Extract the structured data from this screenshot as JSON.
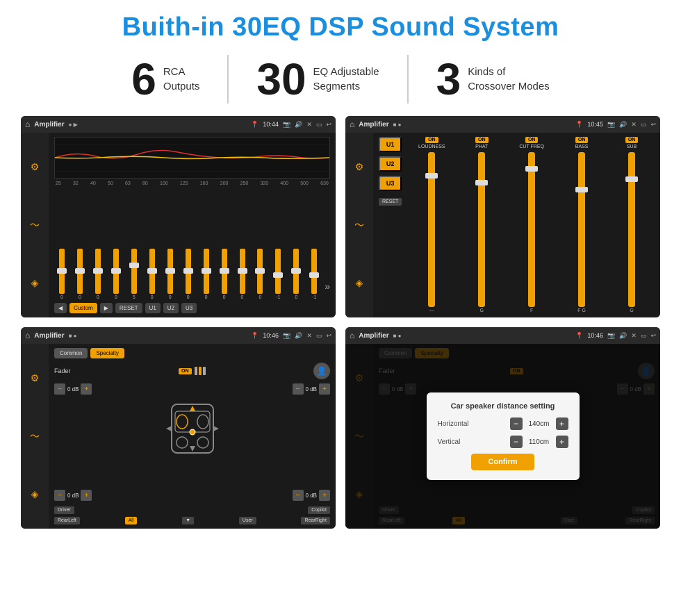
{
  "page": {
    "main_title": "Buith-in 30EQ DSP Sound System",
    "stats": [
      {
        "number": "6",
        "text_line1": "RCA",
        "text_line2": "Outputs"
      },
      {
        "number": "30",
        "text_line1": "EQ Adjustable",
        "text_line2": "Segments"
      },
      {
        "number": "3",
        "text_line1": "Kinds of",
        "text_line2": "Crossover Modes"
      }
    ],
    "screens": [
      {
        "id": "eq-screen",
        "topbar_title": "Amplifier",
        "topbar_time": "10:44",
        "type": "eq"
      },
      {
        "id": "crossover-screen",
        "topbar_title": "Amplifier",
        "topbar_time": "10:45",
        "type": "crossover"
      },
      {
        "id": "fader-screen",
        "topbar_title": "Amplifier",
        "topbar_time": "10:46",
        "type": "fader"
      },
      {
        "id": "dialog-screen",
        "topbar_title": "Amplifier",
        "topbar_time": "10:46",
        "type": "dialog"
      }
    ],
    "eq_freqs": [
      "25",
      "32",
      "40",
      "50",
      "63",
      "80",
      "100",
      "125",
      "160",
      "200",
      "250",
      "320",
      "400",
      "500",
      "630"
    ],
    "eq_values": [
      "0",
      "0",
      "0",
      "0",
      "5",
      "0",
      "0",
      "0",
      "0",
      "0",
      "0",
      "0",
      "-1",
      "0",
      "-1"
    ],
    "eq_buttons": [
      "Custom",
      "RESET",
      "U1",
      "U2",
      "U3"
    ],
    "crossover_channels": [
      {
        "label": "LOUDNESS",
        "on": true
      },
      {
        "label": "PHAT",
        "on": true
      },
      {
        "label": "CUT FREQ",
        "on": true
      },
      {
        "label": "BASS",
        "on": true
      },
      {
        "label": "SUB",
        "on": true
      }
    ],
    "u_buttons": [
      "U1",
      "U2",
      "U3"
    ],
    "fader": {
      "tabs": [
        "Common",
        "Specialty"
      ],
      "active_tab": "Specialty",
      "fader_label": "Fader",
      "fader_on": "ON",
      "vol_controls": [
        {
          "label": "— 0 dB +",
          "left": true
        },
        {
          "label": "— 0 dB +",
          "left": false
        }
      ],
      "vol_controls2": [
        {
          "label": "— 0 dB +",
          "left": true
        },
        {
          "label": "— 0 dB +",
          "left": false
        }
      ],
      "speaker_buttons": [
        "Driver",
        "",
        "",
        "",
        "Copilot"
      ],
      "bottom_buttons": [
        "RearLeft",
        "All",
        "",
        "User",
        "RearRight"
      ]
    },
    "dialog": {
      "title": "Car speaker distance setting",
      "horizontal_label": "Horizontal",
      "horizontal_value": "140cm",
      "vertical_label": "Vertical",
      "vertical_value": "110cm",
      "confirm_label": "Confirm"
    }
  }
}
